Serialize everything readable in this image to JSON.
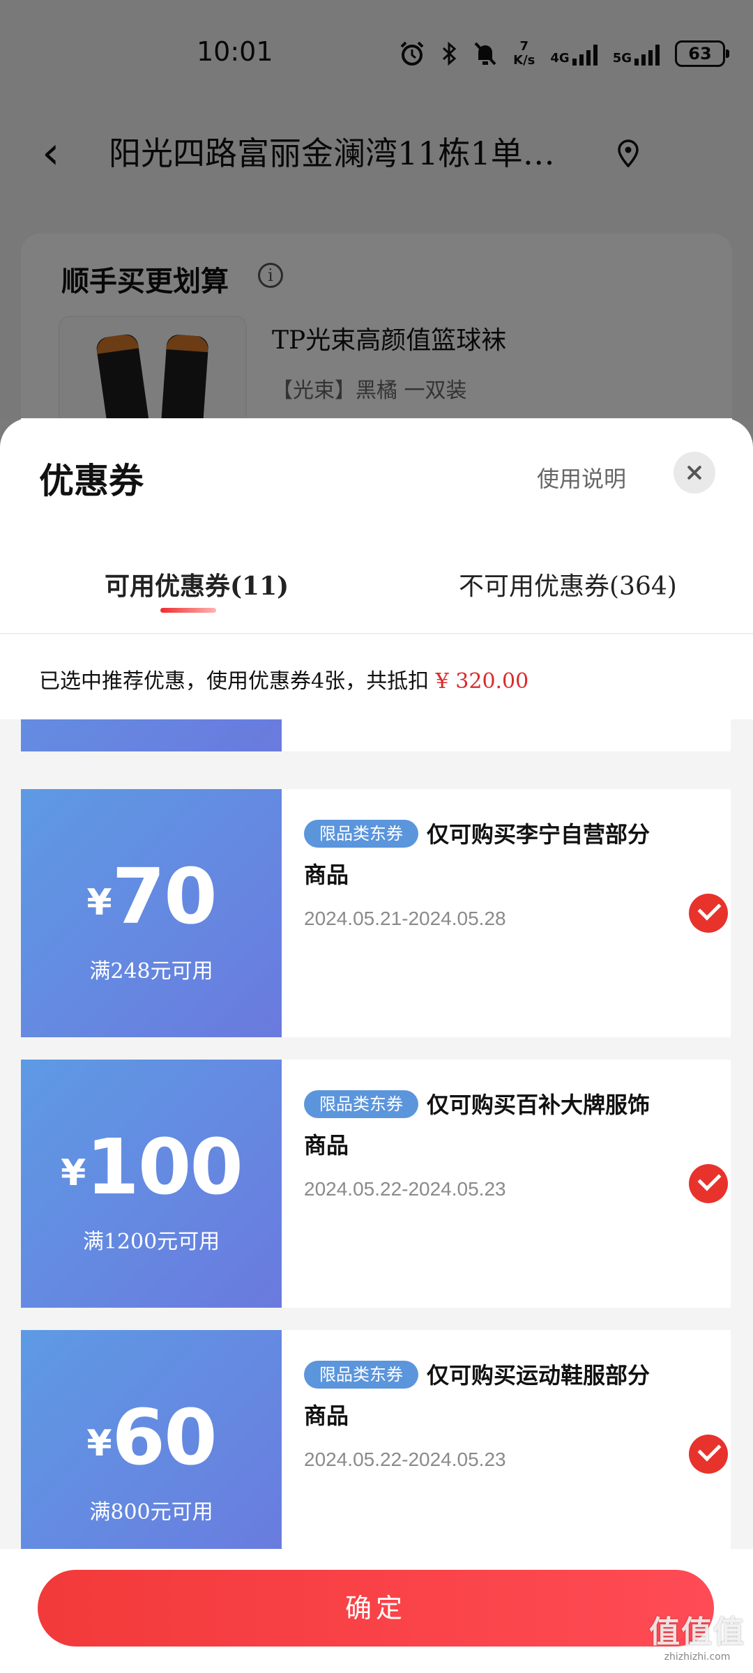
{
  "status_bar": {
    "time": "10:01",
    "net_speed_value": "7",
    "net_speed_unit": "K/s",
    "network_1": "4G",
    "network_2": "5G",
    "battery": "63"
  },
  "header": {
    "address": "阳光四路富丽金澜湾11栋1单…"
  },
  "background_card": {
    "title": "顺手买更划算",
    "product_name": "TP光束高颜值篮球袜",
    "product_spec": "【光束】黑橘 一双装"
  },
  "sheet": {
    "title": "优惠券",
    "usage_link": "使用说明",
    "tabs": [
      {
        "label": "可用优惠券(11)"
      },
      {
        "label": "不可用优惠券(364)"
      }
    ],
    "summary_text": "已选中推荐优惠，使用优惠券4张，共抵扣",
    "summary_amount": "¥ 320.00",
    "coupons": [
      {
        "currency": "¥",
        "amount": "70",
        "threshold": "满248元可用",
        "tag": "限品类东券",
        "description": "仅可购买李宁自营部分商品",
        "dates": "2024.05.21-2024.05.28",
        "selected": true
      },
      {
        "currency": "¥",
        "amount": "100",
        "threshold": "满1200元可用",
        "tag": "限品类东券",
        "description": "仅可购买百补大牌服饰商品",
        "dates": "2024.05.22-2024.05.23",
        "selected": true
      },
      {
        "currency": "¥",
        "amount": "60",
        "threshold": "满800元可用",
        "tag": "限品类东券",
        "description": "仅可购买运动鞋服部分商品",
        "dates": "2024.05.22-2024.05.23",
        "selected": true
      }
    ],
    "confirm_label": "确定"
  },
  "watermark": {
    "main": "值值值",
    "sub": "zhizhizhi.com"
  },
  "colors": {
    "accent_red": "#e8322c",
    "coupon_gradient_start": "#5e9ae4",
    "coupon_gradient_end": "#6a7ade",
    "amount_red": "#d92b2b"
  },
  "icons": [
    "back-arrow-icon",
    "location-pin-icon",
    "info-icon",
    "close-icon",
    "check-icon",
    "alarm-icon",
    "bluetooth-icon",
    "mute-icon",
    "signal-icon",
    "battery-icon"
  ]
}
